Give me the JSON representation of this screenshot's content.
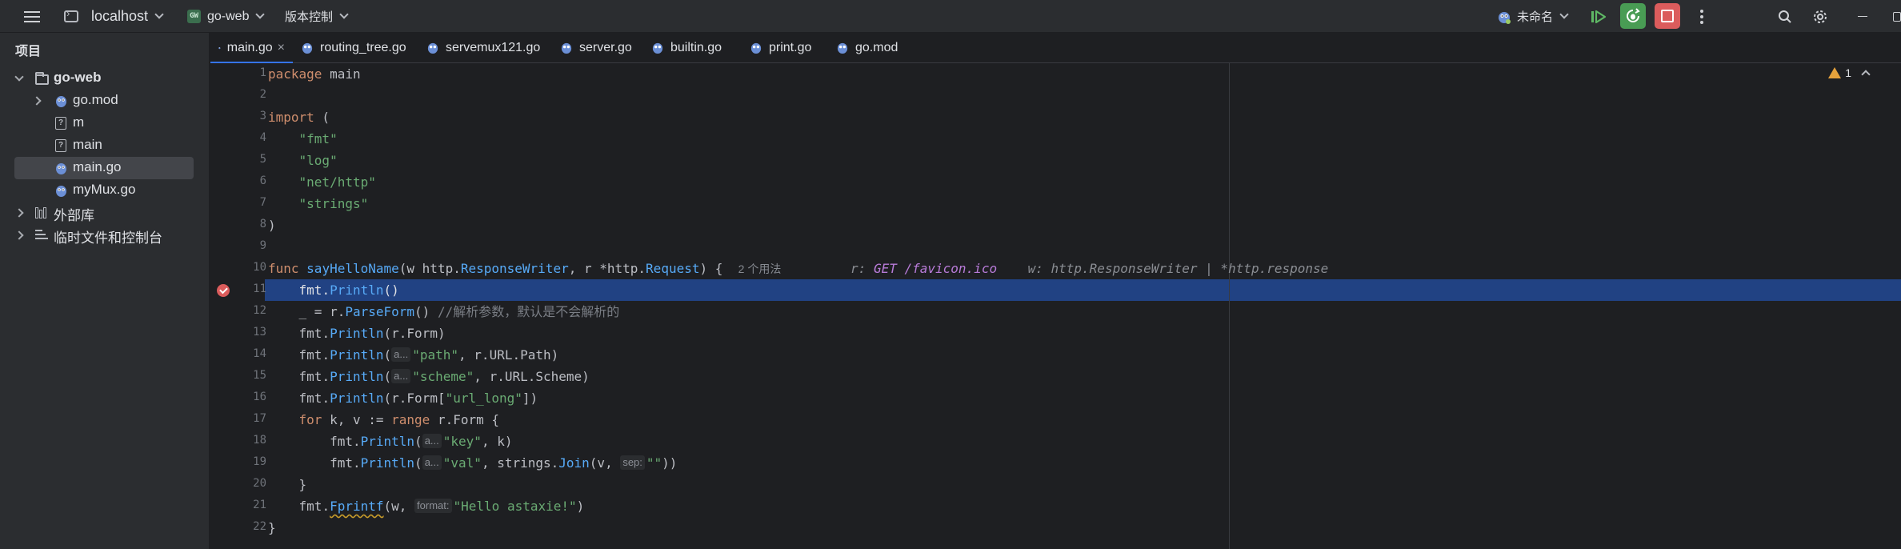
{
  "titlebar": {
    "host": "localhost",
    "project_badge": "GW",
    "project": "go-web",
    "vcs": "版本控制",
    "run_config": "未命名"
  },
  "colors": {
    "accent": "#3574f0",
    "highlight": "#214283",
    "run_green": "#499c54",
    "stop_red": "#db5c5c",
    "warning": "#e6a23c"
  },
  "sidebar": {
    "title": "项目",
    "tree": {
      "root": "go-web",
      "items": [
        {
          "label": "go.mod",
          "icon": "gopher-icon"
        },
        {
          "label": "m",
          "icon": "unknown-file-icon"
        },
        {
          "label": "main",
          "icon": "unknown-file-icon"
        },
        {
          "label": "main.go",
          "icon": "gopher-icon"
        },
        {
          "label": "myMux.go",
          "icon": "gopher-icon"
        }
      ],
      "external_libs": "外部库",
      "scratches": "临时文件和控制台"
    }
  },
  "tabs": [
    "main.go",
    "routing_tree.go",
    "servemux121.go",
    "server.go",
    "builtin.go",
    "print.go",
    "go.mod"
  ],
  "editor": {
    "warning_count": "1",
    "line_numbers": [
      "1",
      "2",
      "3",
      "4",
      "5",
      "6",
      "7",
      "8",
      "9",
      "10",
      "11",
      "12",
      "13",
      "14",
      "15",
      "16",
      "17",
      "18",
      "19",
      "20",
      "21",
      "22"
    ],
    "code": {
      "l1_kw": "package",
      "l1_rest": " main",
      "l3_kw": "import",
      "l3_rest": " (",
      "l4": "\"fmt\"",
      "l5": "\"log\"",
      "l6": "\"net/http\"",
      "l7": "\"strings\"",
      "l8": ")",
      "l10_kw": "func",
      "l10_name": "sayHelloName",
      "l10_a": "(w ",
      "l10_b": "http",
      "l10_c": ".",
      "l10_d": "ResponseWriter",
      "l10_e": ", r *",
      "l10_f": "http",
      "l10_g": ".",
      "l10_h": "Request",
      "l10_i": ") {",
      "l10_usage": "2 个用法",
      "l10_dbg_r_label": "r:",
      "l10_dbg_r_val": "GET /favicon.ico",
      "l10_dbg_w": "w: http.ResponseWriter | *http.response",
      "l11_pkg": "fmt",
      "l11_dot": ".",
      "l11_fn": "Println",
      "l11_rest": "()",
      "l12_a": "_ = r.",
      "l12_fn": "ParseForm",
      "l12_b": "()",
      "l12_cmt": "//解析参数，默认是不会解析的",
      "l13_a": "fmt",
      "l13_b": ".",
      "l13_fn": "Println",
      "l13_rest": "(r.Form)",
      "l14_a": "fmt",
      "l14_b": ".",
      "l14_fn": "Println",
      "l14_c": "(",
      "l14_hint": "a...",
      "l14_str": "\"path\"",
      "l14_rest": ", r.URL.Path)",
      "l15_a": "fmt",
      "l15_b": ".",
      "l15_fn": "Println",
      "l15_c": "(",
      "l15_hint": "a...",
      "l15_str": "\"scheme\"",
      "l15_rest": ", r.URL.Scheme)",
      "l16_a": "fmt",
      "l16_b": ".",
      "l16_fn": "Println",
      "l16_c": "(r.Form[",
      "l16_str": "\"url_long\"",
      "l16_rest": "])",
      "l17_kw": "for",
      "l17_a": " k, v := ",
      "l17_kw2": "range",
      "l17_rest": " r.Form {",
      "l18_a": "fmt",
      "l18_b": ".",
      "l18_fn": "Println",
      "l18_c": "(",
      "l18_hint": "a...",
      "l18_str": "\"key\"",
      "l18_rest": ", k)",
      "l19_a": "fmt",
      "l19_b": ".",
      "l19_fn": "Println",
      "l19_c": "(",
      "l19_hint": "a...",
      "l19_str": "\"val\"",
      "l19_d": ", strings.",
      "l19_fn2": "Join",
      "l19_e": "(v, ",
      "l19_hint2": "sep:",
      "l19_str2": "\"\"",
      "l19_rest": "))",
      "l20": "}",
      "l21_a": "fmt",
      "l21_b": ".",
      "l21_fn": "Fprintf",
      "l21_c": "(w, ",
      "l21_hint": "format:",
      "l21_str": "\"Hello astaxie!\"",
      "l21_rest": ")",
      "l22": "}"
    }
  }
}
